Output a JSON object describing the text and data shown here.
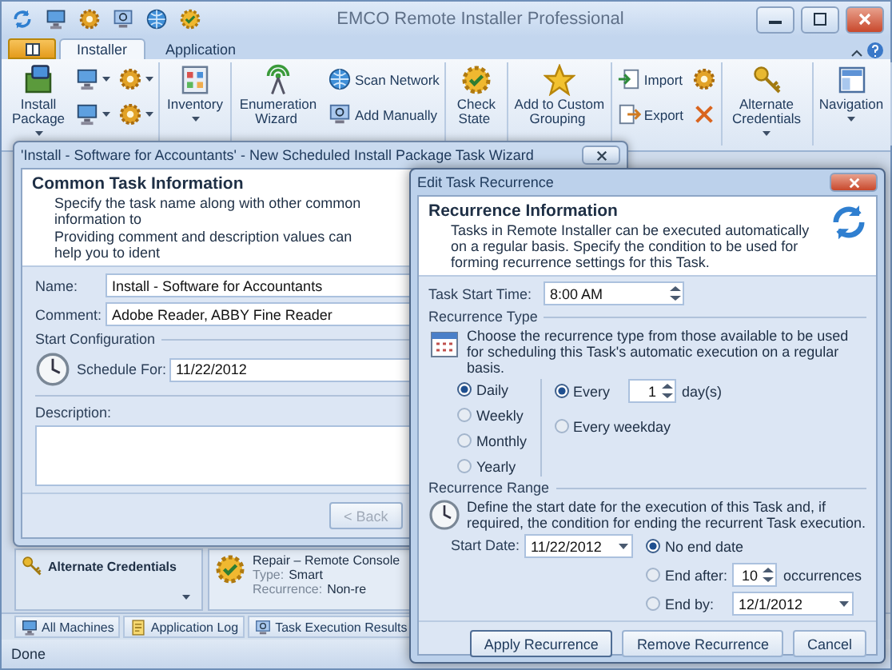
{
  "window": {
    "title": "EMCO Remote Installer Professional"
  },
  "ribbon": {
    "tabs": [
      {
        "label": "Installer",
        "selected": true
      },
      {
        "label": "Application",
        "selected": false
      }
    ],
    "groups": [
      {
        "columns": [
          {
            "kind": "large",
            "label": "Install Package",
            "dropdown": true
          },
          {
            "kind": "stack",
            "items": [
              {
                "dropdown": true
              },
              {
                "dropdown": true
              }
            ]
          },
          {
            "kind": "stack",
            "items": [
              {
                "dropdown": true
              },
              {
                "dropdown": true
              }
            ]
          }
        ]
      },
      {
        "columns": [
          {
            "kind": "large",
            "label": "Inventory",
            "dropdown": true
          }
        ]
      },
      {
        "columns": [
          {
            "kind": "large",
            "label": "Enumeration Wizard",
            "dropdown": false
          },
          {
            "kind": "stack",
            "items": [
              {
                "label": "Scan Network",
                "dropdown": false
              },
              {
                "label": "Add Manually",
                "dropdown": false
              }
            ]
          }
        ]
      },
      {
        "columns": [
          {
            "kind": "large",
            "label": "Check State",
            "dropdown": false
          }
        ]
      },
      {
        "columns": [
          {
            "kind": "large",
            "label": "Add to Custom Grouping",
            "dropdown": false
          }
        ]
      },
      {
        "columns": [
          {
            "kind": "stack",
            "items": [
              {
                "label": "Import",
                "dropdown": false
              },
              {
                "label": "Export",
                "dropdown": false
              }
            ]
          },
          {
            "kind": "stack",
            "items": [
              {
                "dropdown": false
              },
              {
                "dropdown": false
              }
            ]
          }
        ]
      },
      {
        "columns": [
          {
            "kind": "large",
            "label": "Alternate Credentials",
            "dropdown": true
          }
        ]
      },
      {
        "columns": [
          {
            "kind": "large",
            "label": "Navigation",
            "dropdown": true
          }
        ]
      }
    ]
  },
  "wizard": {
    "title": "'Install - Software for Accountants' - New Scheduled Install Package Task Wizard",
    "heading": "Common Task Information",
    "description": [
      "Specify the task name along with other common information to",
      "Providing comment and description values can help you to ident"
    ],
    "fields": [
      {
        "label": "Name:",
        "value": "Install - Software for Accountants"
      },
      {
        "label": "Comment:",
        "value": "Adobe Reader, ABBY Fine Reader"
      }
    ],
    "start_configuration": {
      "legend": "Start Configuration",
      "label": "Schedule For:",
      "value": "11/22/2012"
    },
    "description_label": "Description:",
    "back_button": {
      "label": "< Back",
      "disabled": true
    }
  },
  "credentials_panel": {
    "label": "Alternate Credentials"
  },
  "task_card": {
    "title": "Repair – Remote Console",
    "rows": [
      {
        "label": "Type:",
        "value": "Smart"
      },
      {
        "label": "Recurrence:",
        "value": "Non-re"
      }
    ]
  },
  "bottom_tabs": [
    {
      "label": "All Machines"
    },
    {
      "label": "Application Log"
    },
    {
      "label": "Task Execution Results"
    }
  ],
  "status_bar": {
    "text": "Done"
  },
  "recurrence_dialog": {
    "title": "Edit Task Recurrence",
    "heading": "Recurrence Information",
    "description": "Tasks in Remote Installer can be executed automatically on a regular basis. Specify the condition to be used for forming recurrence settings for this Task.",
    "start_time": {
      "label": "Task Start Time:",
      "value": "8:00 AM"
    },
    "type_section": {
      "legend": "Recurrence Type",
      "description": "Choose the recurrence type from those available to be used for scheduling this Task's automatic execution on a regular basis.",
      "patterns": [
        {
          "label": "Daily",
          "selected": true
        },
        {
          "label": "Weekly",
          "selected": false
        },
        {
          "label": "Monthly",
          "selected": false
        },
        {
          "label": "Yearly",
          "selected": false
        }
      ],
      "daily_options": [
        {
          "kind": "every",
          "label": "Every",
          "value": "1",
          "unit": "day(s)",
          "selected": true
        },
        {
          "kind": "weekday",
          "label": "Every weekday",
          "selected": false
        }
      ]
    },
    "range_section": {
      "legend": "Recurrence Range",
      "description": "Define the start date for the execution of this Task and, if required, the condition for ending the recurrent Task execution.",
      "start_date": {
        "label": "Start Date:",
        "value": "11/22/2012"
      },
      "end_options": [
        {
          "kind": "none",
          "label": "No end date",
          "selected": true
        },
        {
          "kind": "after",
          "label": "End after:",
          "value": "10",
          "unit": "occurrences",
          "selected": false
        },
        {
          "kind": "by",
          "label": "End by:",
          "value": "12/1/2012",
          "selected": false
        }
      ]
    },
    "buttons": [
      {
        "label": "Apply Recurrence",
        "default": true
      },
      {
        "label": "Remove Recurrence",
        "default": false
      },
      {
        "label": "Cancel",
        "default": false
      }
    ]
  }
}
